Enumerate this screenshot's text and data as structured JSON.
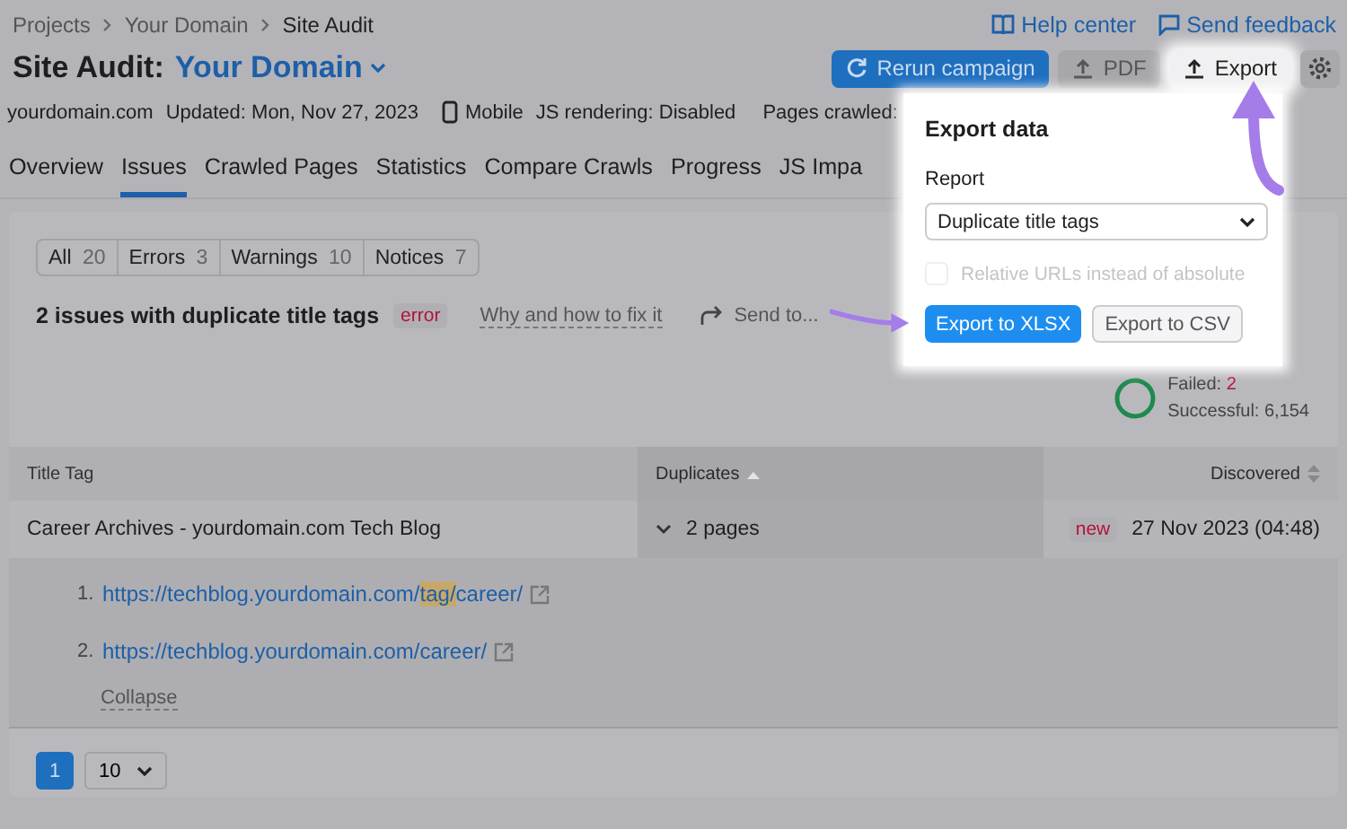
{
  "breadcrumbs": [
    "Projects",
    "Your Domain",
    "Site Audit"
  ],
  "header_links": [
    {
      "label": "Help center",
      "kind": "book"
    },
    {
      "label": "Send feedback",
      "kind": "chat"
    }
  ],
  "title": {
    "prefix": "Site Audit:",
    "domain": "Your Domain"
  },
  "actions": [
    {
      "label": "Rerun campaign",
      "kind": "primary"
    },
    {
      "label": "PDF",
      "kind": "secondary"
    },
    {
      "label": "Export",
      "kind": "highlight"
    }
  ],
  "info": {
    "domain": "yourdomain.com",
    "updated": "Updated: Mon, Nov 27, 2023",
    "device": "Mobile",
    "js": "JS rendering: Disabled",
    "pages": "Pages crawled:"
  },
  "tabs": [
    {
      "label": "Overview",
      "selected": false
    },
    {
      "label": "Issues",
      "selected": true
    },
    {
      "label": "Crawled Pages",
      "selected": false
    },
    {
      "label": "Statistics",
      "selected": false
    },
    {
      "label": "Compare Crawls",
      "selected": false
    },
    {
      "label": "Progress",
      "selected": false
    },
    {
      "label": "JS Impa",
      "selected": false
    }
  ],
  "filters": [
    {
      "label": "All",
      "count": "20"
    },
    {
      "label": "Errors",
      "count": "3"
    },
    {
      "label": "Warnings",
      "count": "10"
    },
    {
      "label": "Notices",
      "count": "7"
    }
  ],
  "issue": {
    "title": "2 issues with duplicate title tags",
    "badge": "error",
    "help": "Why and how to fix it",
    "send": "Send to..."
  },
  "checks": {
    "failed_label": "Failed:",
    "failed": "2",
    "successful": "Successful: 6,154"
  },
  "table": {
    "columns": [
      {
        "label": "Title Tag",
        "sortable": false,
        "sorted": false
      },
      {
        "label": "Duplicates",
        "sortable": true,
        "sorted": true
      },
      {
        "label": "Discovered",
        "sortable": true,
        "sorted": false
      }
    ],
    "rows": [
      {
        "title": "Career Archives - yourdomain.com Tech Blog",
        "duplicates": "2 pages",
        "expanded": true,
        "badge": "new",
        "discovered": "27 Nov 2023 (04:48)",
        "pages": [
          {
            "number": "1.",
            "url": [
              {
                "text": "https://techblog.yourdomain.com/",
                "highlighted": false
              },
              {
                "text": "tag/",
                "highlighted": true
              },
              {
                "text": "career/",
                "highlighted": false
              }
            ]
          },
          {
            "number": "2.",
            "url": [
              {
                "text": "https://techblog.yourdomain.com/career/",
                "highlighted": false
              }
            ]
          }
        ],
        "collapse": "Collapse"
      }
    ]
  },
  "pagination": {
    "pages": [
      {
        "label": "1",
        "selected": true
      }
    ],
    "per_page": "10"
  },
  "export_popup": {
    "title": "Export data",
    "report_label": "Report",
    "report": "Duplicate title tags",
    "relative_urls": {
      "label": "Relative URLs instead of absolute",
      "checked": false,
      "disabled": true
    },
    "buttons": [
      {
        "label": "Export to XLSX",
        "kind": "primary"
      },
      {
        "label": "Export to CSV",
        "kind": "secondary"
      }
    ]
  }
}
